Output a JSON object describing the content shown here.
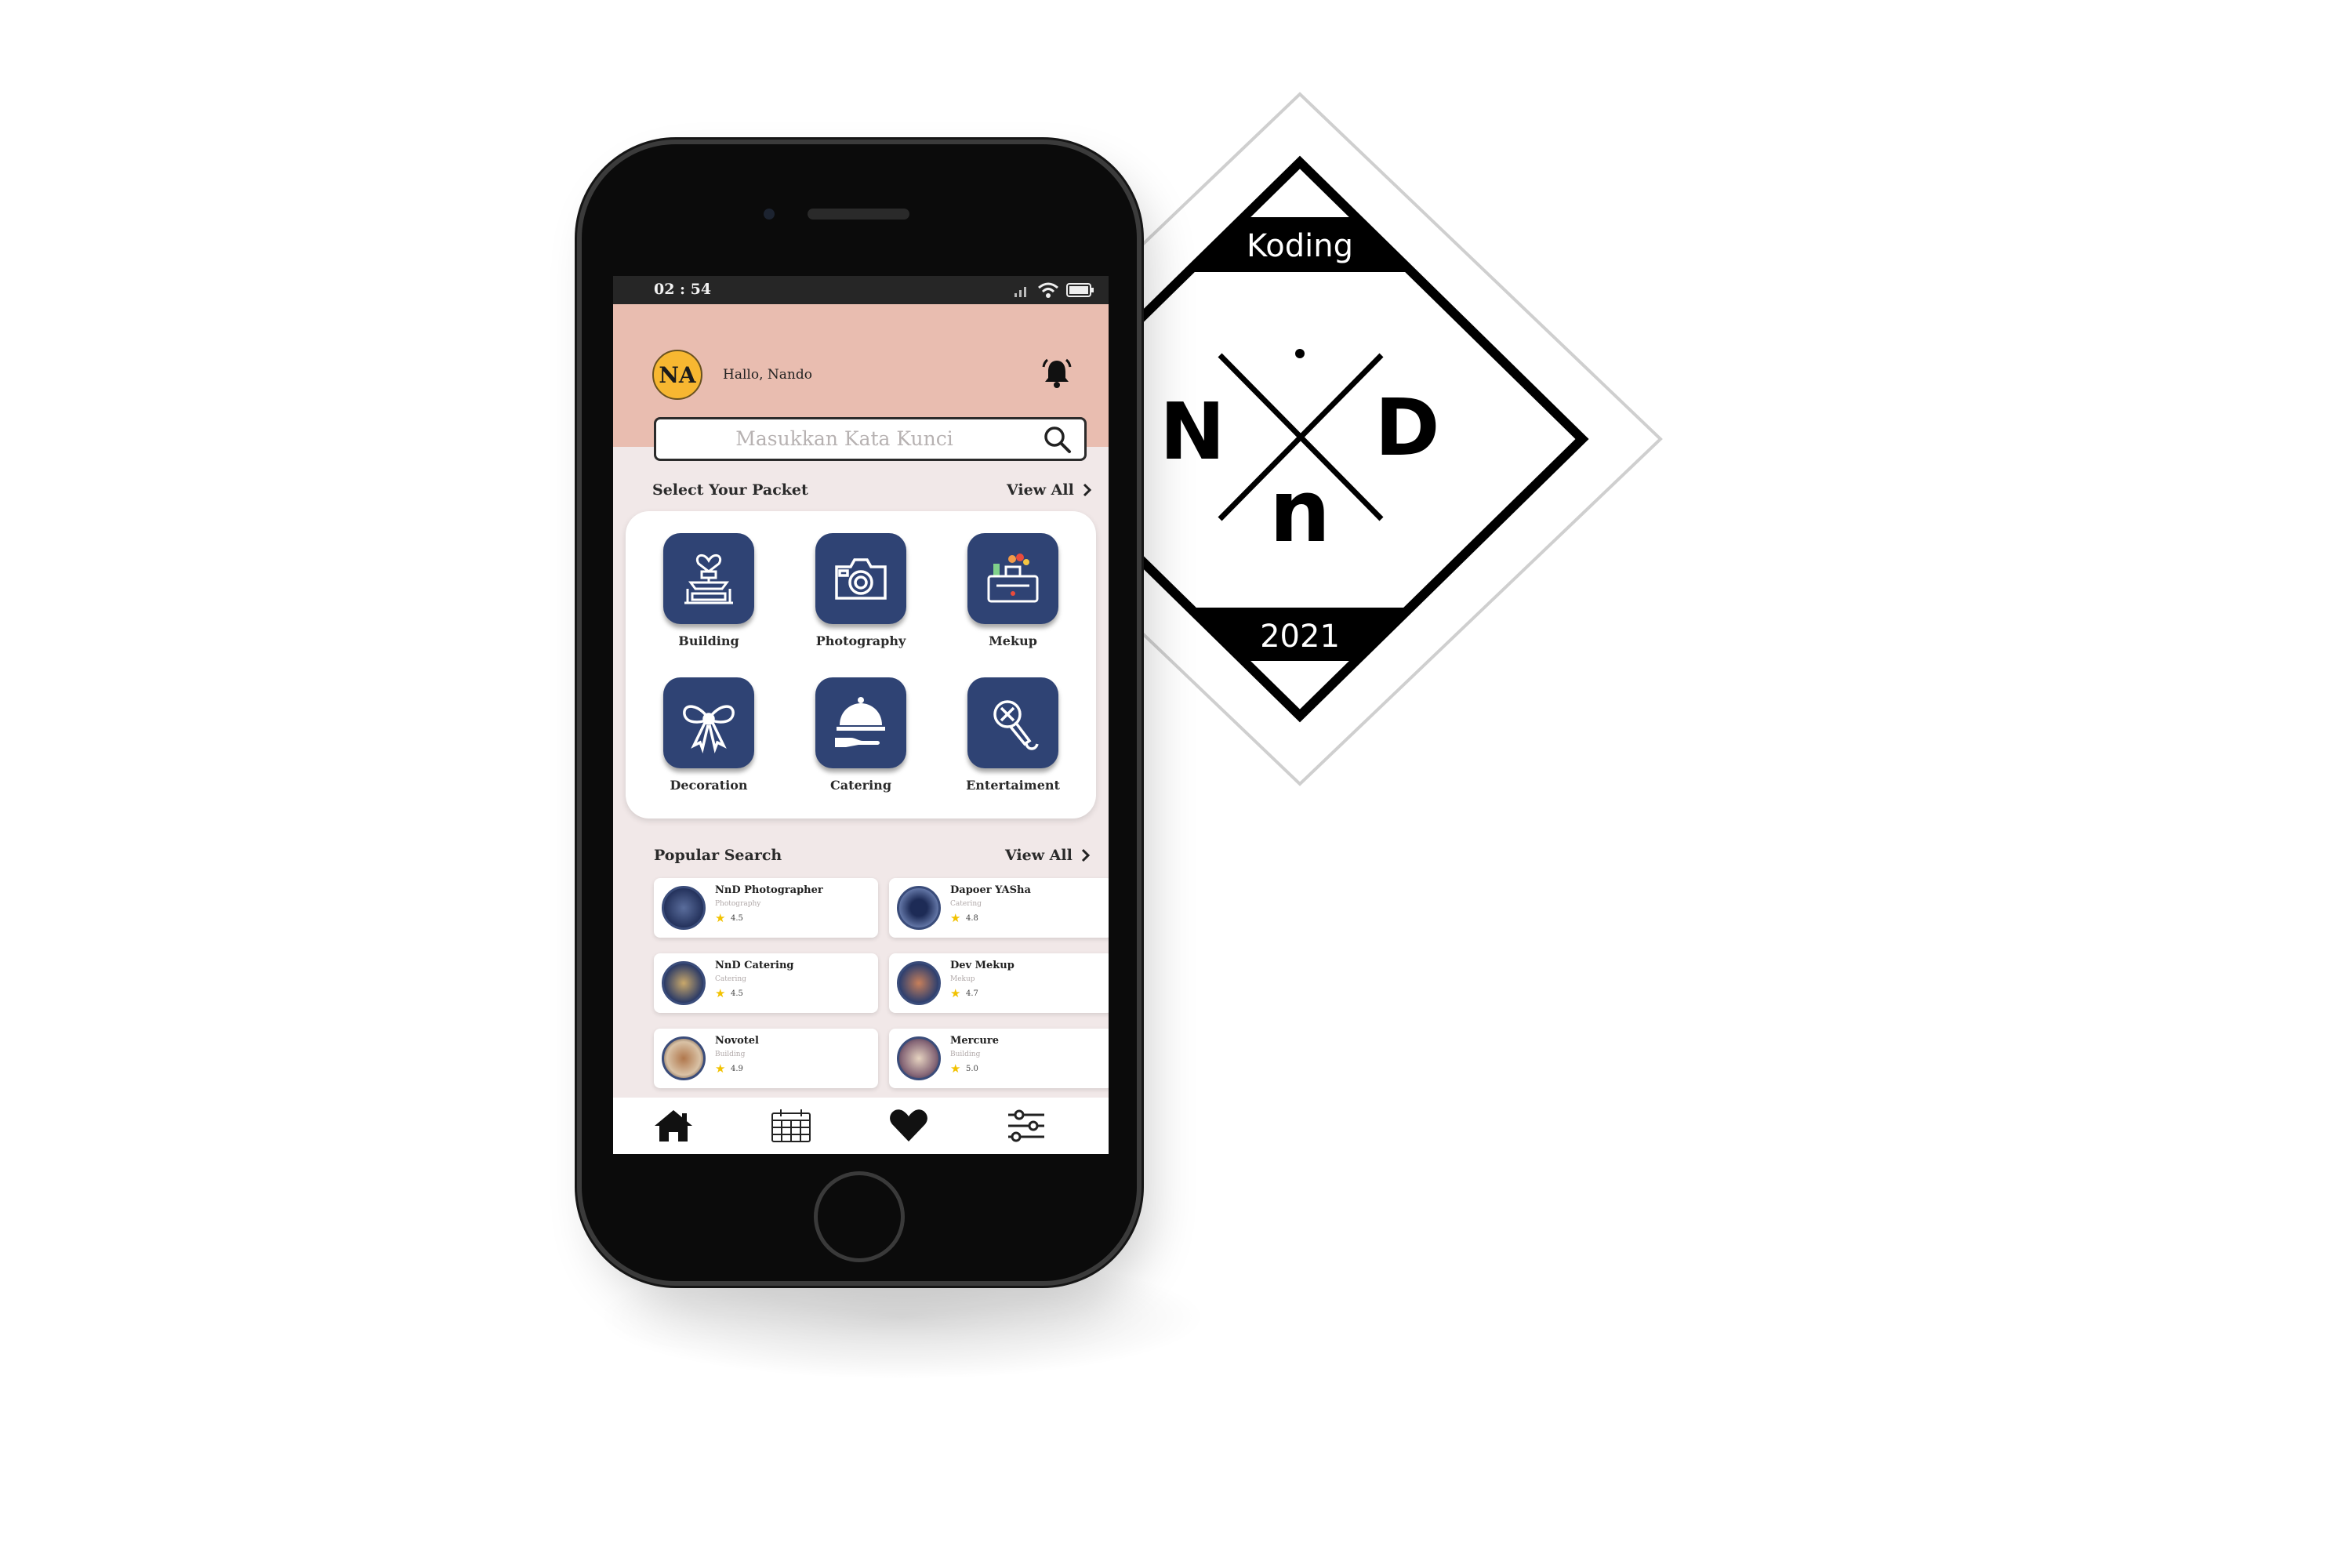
{
  "logo": {
    "top_text": "Koding",
    "bottom_text": "2021",
    "letter_left": "N",
    "letter_right": "D",
    "letter_bottom": "n"
  },
  "status_bar": {
    "time": "02 : 54"
  },
  "header": {
    "avatar_initials": "NA",
    "greeting": "Hallo, Nando",
    "bell_icon": "bell-icon"
  },
  "search": {
    "placeholder": "Masukkan Kata Kunci",
    "icon": "search-icon"
  },
  "packets": {
    "title": "Select Your Packet",
    "view_all": "View All",
    "items": [
      {
        "label": "Building",
        "icon": "fountain-icon"
      },
      {
        "label": "Photography",
        "icon": "camera-icon"
      },
      {
        "label": "Mekup",
        "icon": "makeup-icon"
      },
      {
        "label": "Decoration",
        "icon": "ribbon-icon"
      },
      {
        "label": "Catering",
        "icon": "cloche-icon"
      },
      {
        "label": "Entertaiment",
        "icon": "microphone-icon"
      }
    ]
  },
  "popular": {
    "title": "Popular Search",
    "view_all": "View All",
    "items": [
      {
        "name": "NnD Photographer",
        "category": "Photography",
        "rating": "4.5"
      },
      {
        "name": "Dapoer YASha",
        "category": "Catering",
        "rating": "4.8"
      },
      {
        "name": "NnD Catering",
        "category": "Catering",
        "rating": "4.5"
      },
      {
        "name": "Dev Mekup",
        "category": "Mekup",
        "rating": "4.7"
      },
      {
        "name": "Novotel",
        "category": "Building",
        "rating": "4.9"
      },
      {
        "name": "Mercure",
        "category": "Building",
        "rating": "5.0"
      }
    ]
  },
  "navbar": {
    "items": [
      "home-icon",
      "calendar-icon",
      "heart-icon",
      "sliders-icon"
    ]
  },
  "colors": {
    "header_bg": "#e9bdb0",
    "screen_bg": "#f1e8e8",
    "icon_tile": "#2f4374",
    "avatar": "#f7b731",
    "star": "#f2c200"
  }
}
